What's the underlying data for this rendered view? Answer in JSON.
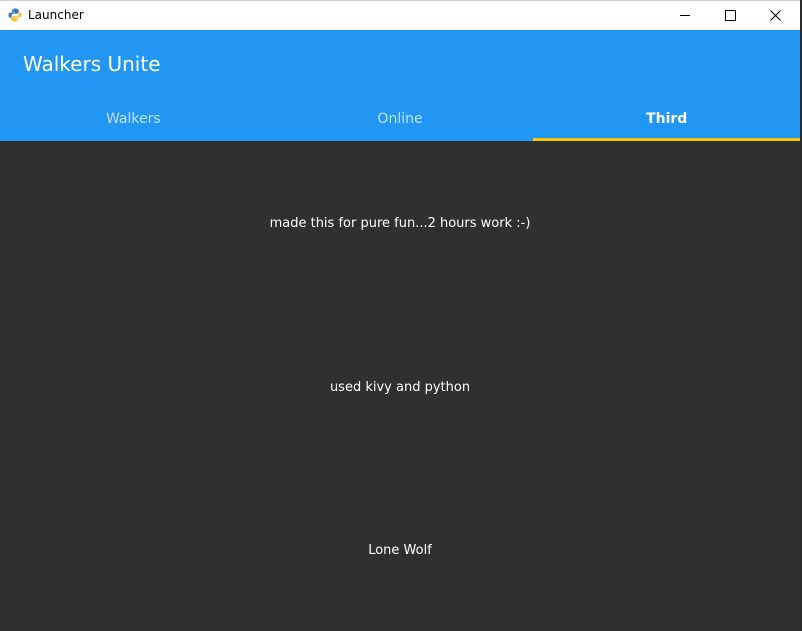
{
  "window": {
    "title": "Launcher",
    "icon": "python-icon",
    "controls": {
      "minimize": "minimize-icon",
      "maximize": "maximize-icon",
      "close": "close-icon"
    }
  },
  "app": {
    "title": "Walkers Unite",
    "header_color": "#2196f3",
    "indicator_color": "#f7c600",
    "tabs": [
      {
        "label": "Walkers",
        "active": false
      },
      {
        "label": "Online",
        "active": false
      },
      {
        "label": "Third",
        "active": true
      }
    ]
  },
  "content": {
    "background": "#303030",
    "lines": [
      "made this for pure fun...2 hours work :-)",
      "used kivy and python",
      "Lone Wolf"
    ]
  }
}
